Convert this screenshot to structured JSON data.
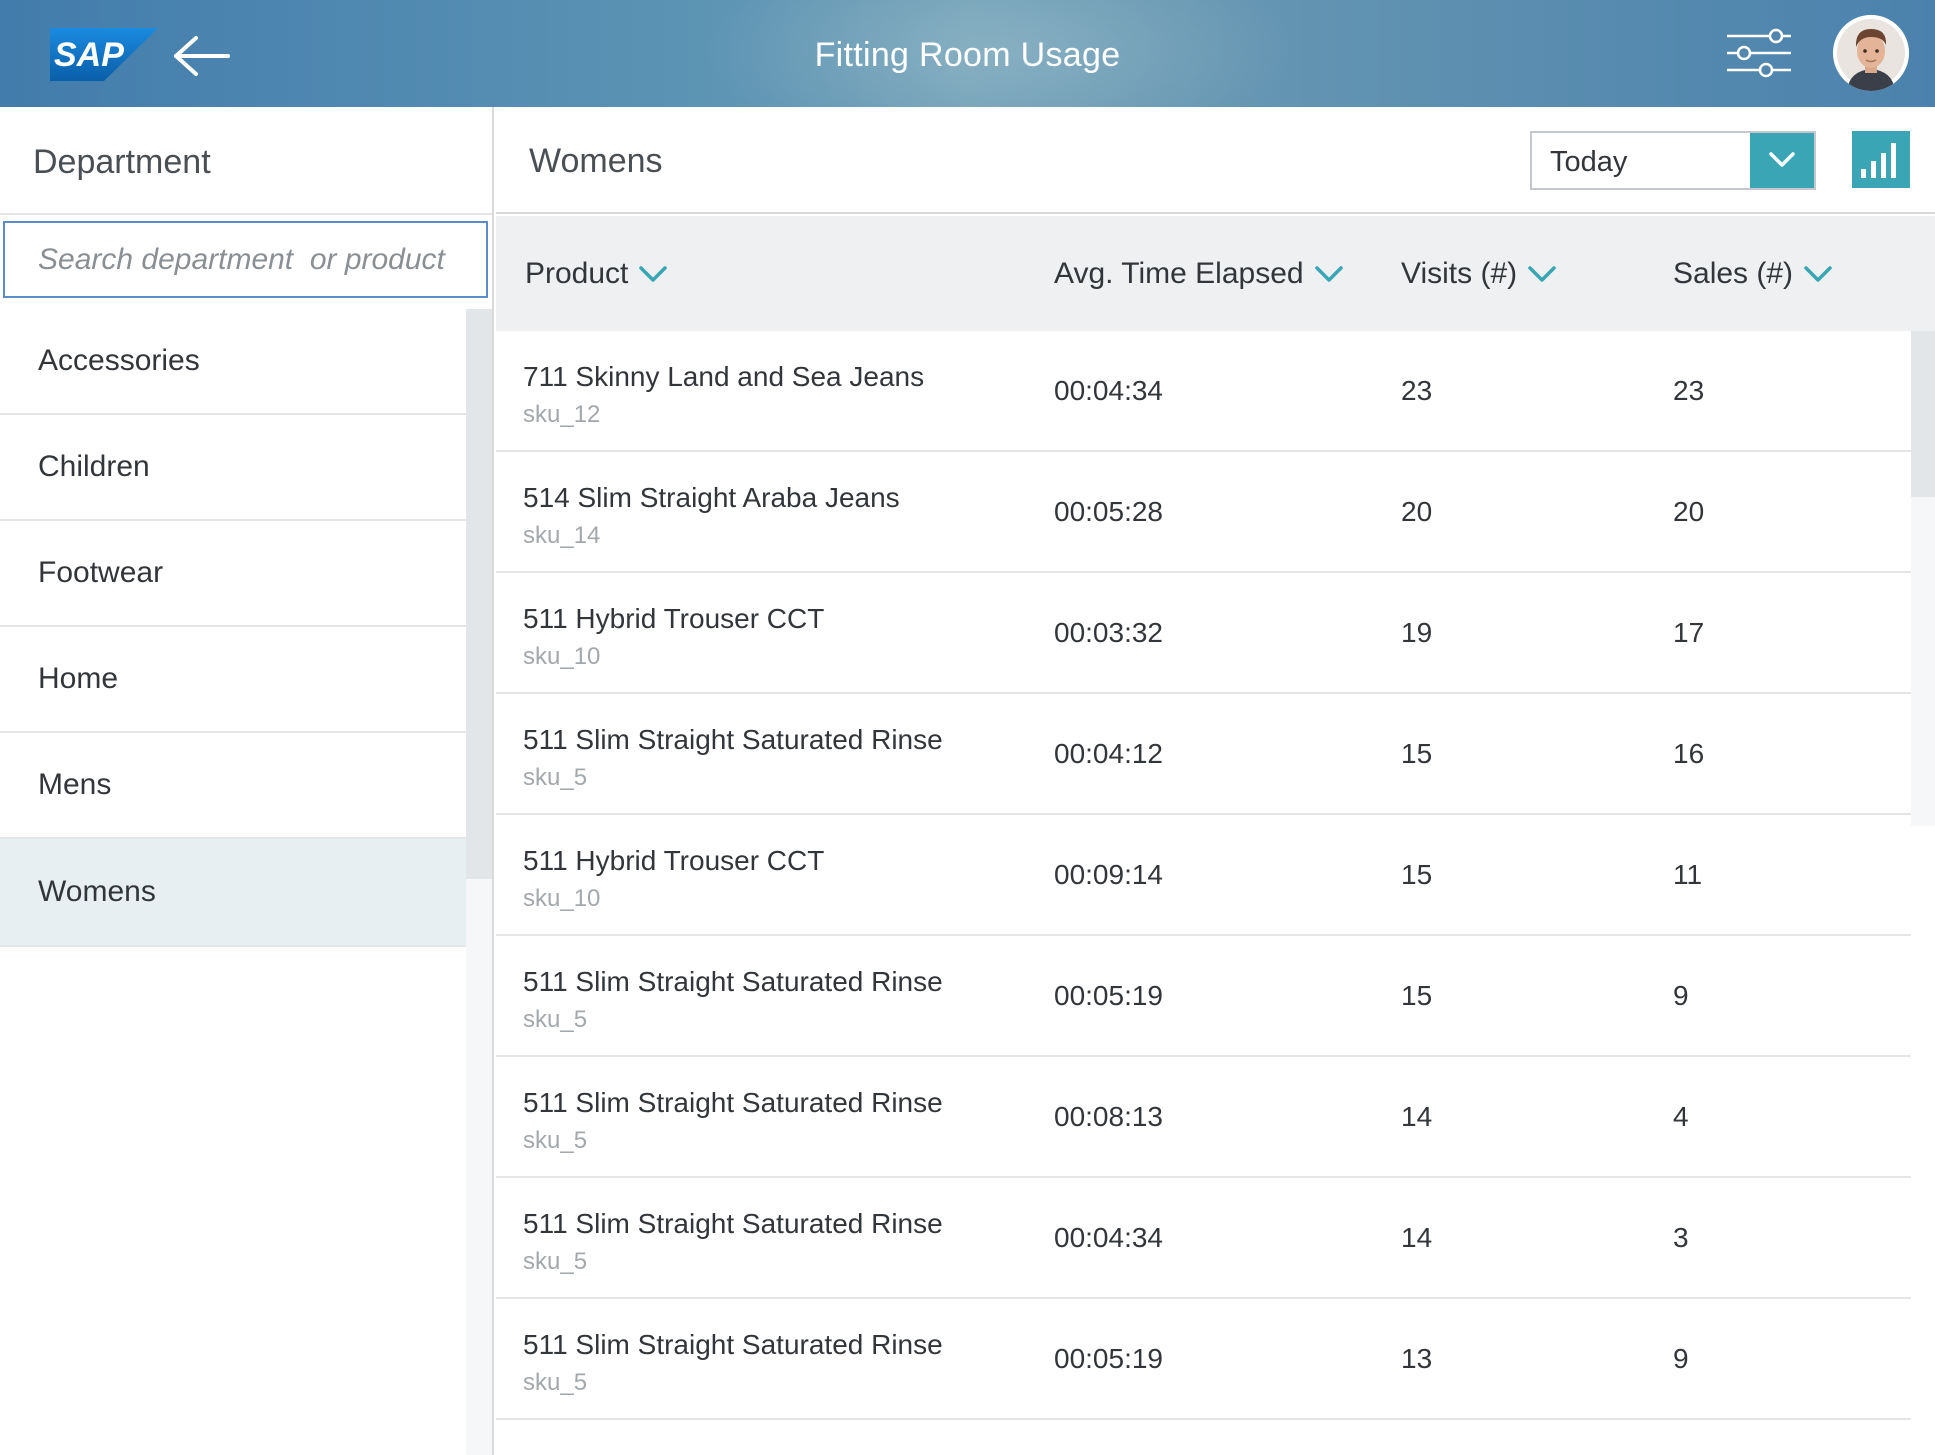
{
  "header": {
    "logo_text": "SAP",
    "title": "Fitting Room Usage",
    "icons": {
      "back": "back-arrow-icon",
      "settings": "settings-sliders-icon",
      "avatar": "user-avatar"
    }
  },
  "sidebar": {
    "title": "Department",
    "search_placeholder": "Search department  or product",
    "items": [
      {
        "label": "Accessories"
      },
      {
        "label": "Children"
      },
      {
        "label": "Footwear"
      },
      {
        "label": "Home"
      },
      {
        "label": "Mens"
      },
      {
        "label": "Womens",
        "selected": true
      }
    ]
  },
  "main": {
    "title": "Womens",
    "period_select": {
      "value": "Today"
    },
    "chart_button_icon": "bar-chart-icon",
    "columns": [
      {
        "label": "Product"
      },
      {
        "label": "Avg. Time Elapsed"
      },
      {
        "label": "Visits (#)"
      },
      {
        "label": "Sales (#)"
      }
    ],
    "rows": [
      {
        "name": "711 Skinny Land and Sea Jeans",
        "sku": "sku_12",
        "time": "00:04:34",
        "visits": "23",
        "sales": "23"
      },
      {
        "name": "514 Slim Straight Araba Jeans",
        "sku": "sku_14",
        "time": "00:05:28",
        "visits": "20",
        "sales": "20"
      },
      {
        "name": "511 Hybrid Trouser CCT",
        "sku": "sku_10",
        "time": "00:03:32",
        "visits": "19",
        "sales": "17"
      },
      {
        "name": "511 Slim Straight Saturated Rinse",
        "sku": "sku_5",
        "time": "00:04:12",
        "visits": "15",
        "sales": "16"
      },
      {
        "name": "511 Hybrid Trouser CCT",
        "sku": "sku_10",
        "time": "00:09:14",
        "visits": "15",
        "sales": "11"
      },
      {
        "name": "511 Slim Straight Saturated Rinse",
        "sku": "sku_5",
        "time": "00:05:19",
        "visits": "15",
        "sales": "9"
      },
      {
        "name": "511 Slim Straight Saturated Rinse",
        "sku": "sku_5",
        "time": "00:08:13",
        "visits": "14",
        "sales": "4"
      },
      {
        "name": "511 Slim Straight Saturated Rinse",
        "sku": "sku_5",
        "time": "00:04:34",
        "visits": "14",
        "sales": "3"
      },
      {
        "name": "511 Slim Straight Saturated Rinse",
        "sku": "sku_5",
        "time": "00:05:19",
        "visits": "13",
        "sales": "9"
      }
    ]
  },
  "colors": {
    "accent": "#3aa6b5",
    "shell": "#5b93b4",
    "selected_row": "#e8eff3",
    "header_row": "#eef0f2"
  }
}
